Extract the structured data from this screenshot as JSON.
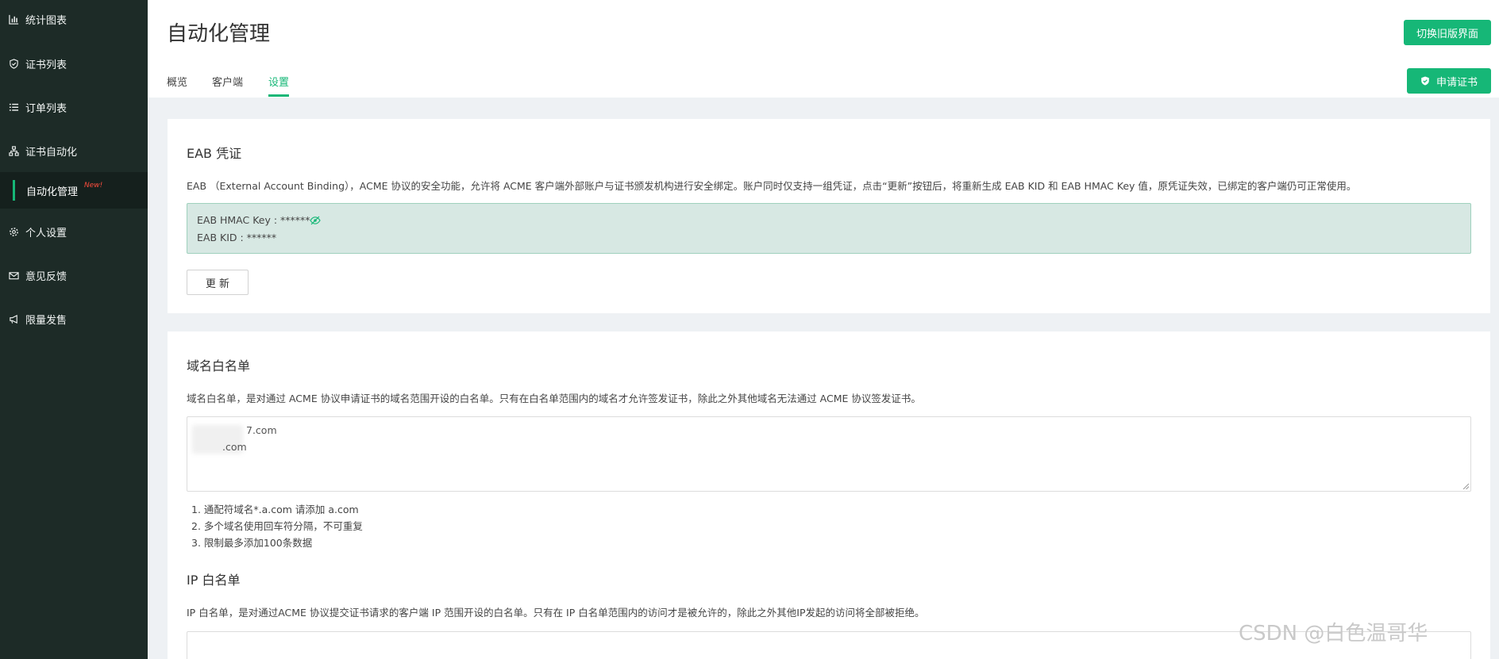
{
  "sidebar": {
    "items": [
      {
        "label": "统计图表",
        "icon": "bar-chart-icon"
      },
      {
        "label": "证书列表",
        "icon": "shield-check-icon"
      },
      {
        "label": "订单列表",
        "icon": "list-icon"
      },
      {
        "label": "证书自动化",
        "icon": "sitemap-icon"
      },
      {
        "label": "个人设置",
        "icon": "gear-icon"
      },
      {
        "label": "意见反馈",
        "icon": "mail-icon"
      },
      {
        "label": "限量发售",
        "icon": "megaphone-icon"
      }
    ],
    "active_sub": {
      "label": "自动化管理",
      "badge": "New!"
    }
  },
  "header": {
    "title": "自动化管理",
    "switch_button": "切换旧版界面",
    "apply_button": "申请证书",
    "tabs": [
      {
        "label": "概览"
      },
      {
        "label": "客户端"
      },
      {
        "label": "设置",
        "active": true
      }
    ]
  },
  "eab": {
    "title": "EAB 凭证",
    "description": "EAB （External Account Binding），ACME 协议的安全功能，允许将 ACME 客户端外部账户与证书颁发机构进行安全绑定。账户同时仅支持一组凭证，点击“更新”按钮后，将重新生成 EAB KID 和 EAB HMAC Key 值，原凭证失效，已绑定的客户端仍可正常使用。",
    "hmac_line": "EAB HMAC Key : ******",
    "kid_line": "EAB KID : ******",
    "update_button": "更 新"
  },
  "domain_whitelist": {
    "title": "域名白名单",
    "description": "域名白名单，是对通过 ACME 协议申请证书的域名范围开设的白名单。只有在白名单范围内的域名才允许签发证书，除此之外其他域名无法通过 ACME 协议签发证书。",
    "entries": [
      "7.com",
      ".com"
    ],
    "tips": [
      "1. 通配符域名*.a.com 请添加 a.com",
      "2. 多个域名使用回车符分隔，不可重复",
      "3. 限制最多添加100条数据"
    ]
  },
  "ip_whitelist": {
    "title": "IP 白名单",
    "description": "IP 白名单，是对通过ACME 协议提交证书请求的客户端 IP 范围开设的白名单。只有在 IP 白名单范围内的访问才是被允许的，除此之外其他IP发起的访问将全部被拒绝。"
  },
  "watermark": "CSDN @白色温哥华",
  "colors": {
    "accent": "#16b777",
    "sidebar_bg": "#1d2b27",
    "new_badge": "#ff4d3d"
  }
}
